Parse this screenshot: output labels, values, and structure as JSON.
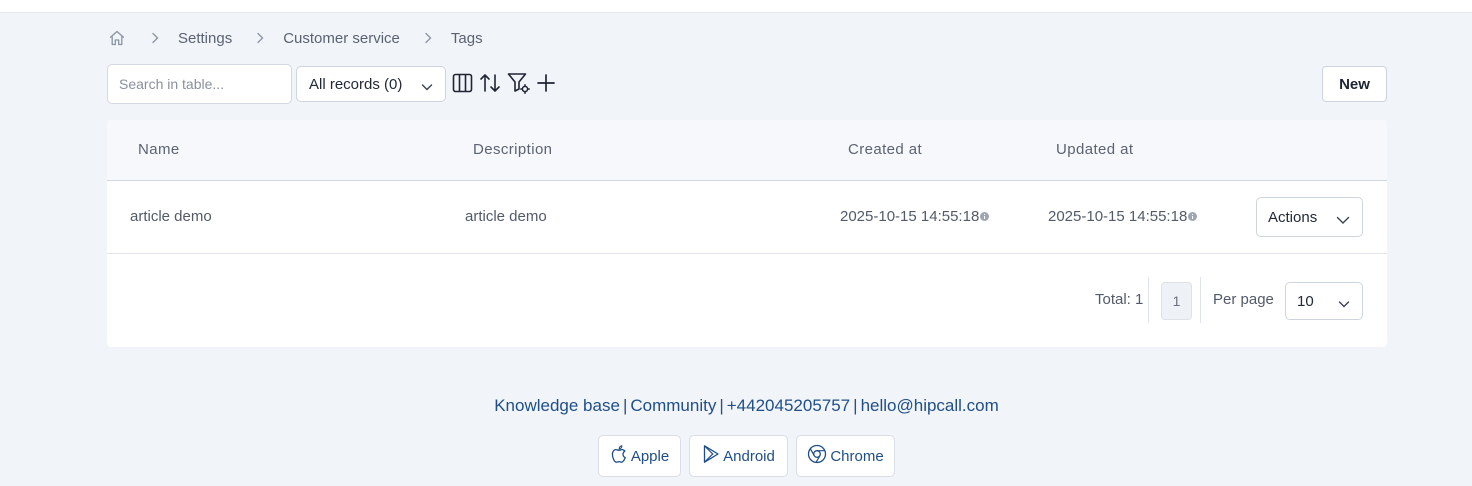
{
  "breadcrumb": {
    "items": [
      "Settings",
      "Customer service",
      "Tags"
    ]
  },
  "toolbar": {
    "search_placeholder": "Search in table...",
    "records_filter": "All records (0)",
    "new_label": "New"
  },
  "table": {
    "columns": [
      "Name",
      "Description",
      "Created at",
      "Updated at"
    ],
    "rows": [
      {
        "name": "article demo",
        "description": "article demo",
        "created_at": "2025-10-15 14:55:18",
        "updated_at": "2025-10-15 14:55:18",
        "actions_label": "Actions"
      }
    ]
  },
  "pagination": {
    "total_label": "Total: 1",
    "current_page": "1",
    "per_page_label": "Per page",
    "per_page_value": "10"
  },
  "footer": {
    "links": [
      "Knowledge base",
      "Community",
      "+442045205757",
      "hello@hipcall.com"
    ],
    "separator": "|",
    "stores": [
      "Apple",
      "Android",
      "Chrome"
    ]
  },
  "colors": {
    "background": "#f1f4f8",
    "link": "#1f4f86",
    "border": "#cfd5de"
  },
  "icons": {
    "home": "home-icon",
    "breadcrumb_separator": "chevron-right-icon",
    "columns": "columns-icon",
    "sort": "sort-icon",
    "filter": "filter-settings-icon",
    "add": "plus-icon",
    "info": "info-icon",
    "apple": "apple-icon",
    "android": "play-store-icon",
    "chrome": "chrome-icon"
  }
}
